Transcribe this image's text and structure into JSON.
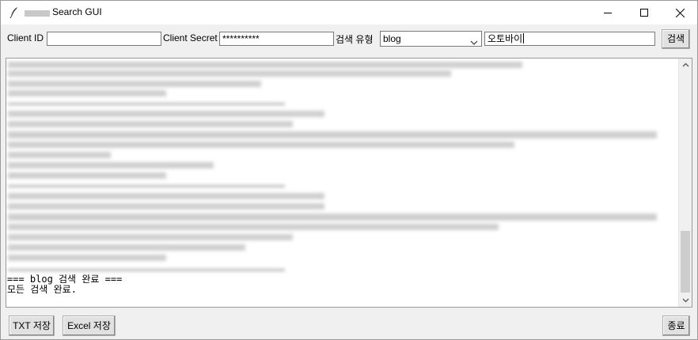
{
  "window": {
    "title": "Search GUI",
    "icon": "feather-icon"
  },
  "toolbar": {
    "client_id_label": "Client ID",
    "client_id_value": "",
    "client_secret_label": "Client Secret",
    "client_secret_value": "**********",
    "search_type_label": "검색 유형",
    "search_type_selected": "blog",
    "query_value": "오토바이",
    "search_button": "검색"
  },
  "output": {
    "result_lines": [
      "=== blog 검색 완료 ===",
      "모든 검색 완료."
    ]
  },
  "footer": {
    "txt_save_button": "TXT 저장",
    "excel_save_button": "Excel 저장",
    "exit_button": "종료"
  }
}
